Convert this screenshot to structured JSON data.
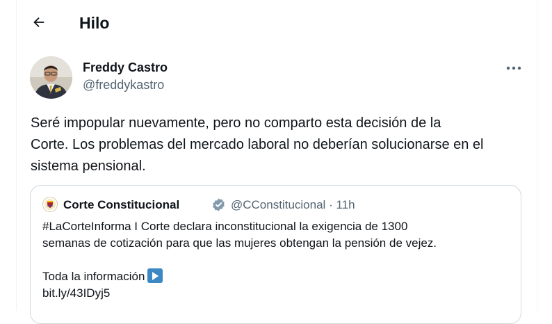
{
  "header": {
    "title": "Hilo"
  },
  "tweet": {
    "author_name": "Freddy Castro",
    "author_handle": "@freddykastro",
    "text": "Seré impopular nuevamente, pero no comparto esta decisión de la\nCorte. Los problemas del mercado laboral no deberían solucionarse en el\nsistema pensional."
  },
  "quote": {
    "author_name": "Corte Constitucional",
    "author_handle": "@CConstitucional",
    "separator": "·",
    "time": "11h",
    "text_line1": "#LaCorteInforma I Corte declara inconstitucional la exigencia de 1300",
    "text_line2": "semanas de cotización para que las mujeres obtengan la pensión de vejez.",
    "info_label": "Toda la información",
    "link": "bit.ly/43IDyj5"
  },
  "icons": {
    "back": "arrow-left-icon",
    "more": "more-horizontal-icon",
    "verified": "verified-badge-icon",
    "play": "play-button-emoji"
  },
  "colors": {
    "text": "#0f1419",
    "secondary": "#536471",
    "border": "#cfd9de",
    "verified_badge": "#829aab",
    "play_box": "#3b88c3"
  }
}
